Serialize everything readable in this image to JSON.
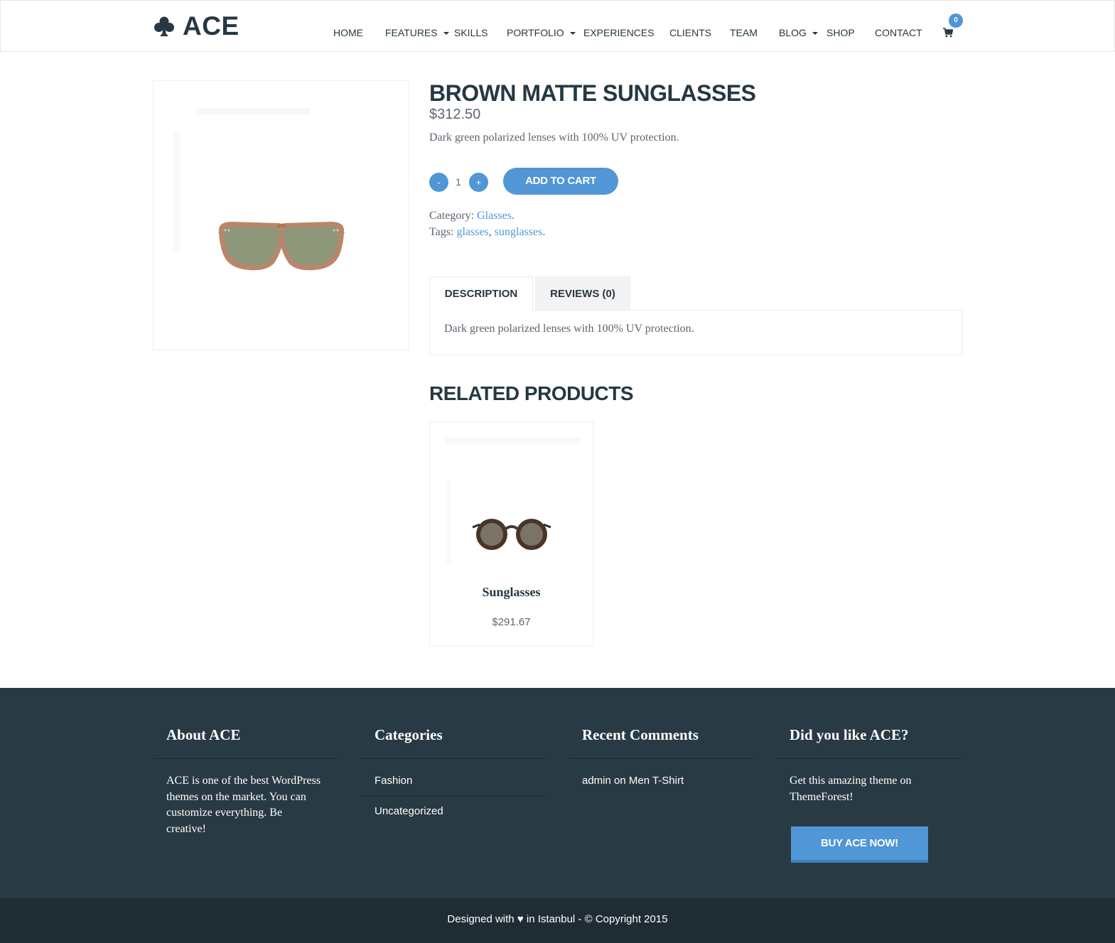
{
  "brand": {
    "logo_icon": "club-suit-icon",
    "name": "ACE"
  },
  "nav": {
    "items": [
      {
        "label": "HOME",
        "has_dropdown": false
      },
      {
        "label": "FEATURES",
        "has_dropdown": true
      },
      {
        "label": "SKILLS",
        "has_dropdown": false
      },
      {
        "label": "PORTFOLIO",
        "has_dropdown": true
      },
      {
        "label": "EXPERIENCES",
        "has_dropdown": false
      },
      {
        "label": "CLIENTS",
        "has_dropdown": false
      },
      {
        "label": "TEAM",
        "has_dropdown": false
      },
      {
        "label": "BLOG",
        "has_dropdown": true
      },
      {
        "label": "SHOP",
        "has_dropdown": false
      },
      {
        "label": "CONTACT",
        "has_dropdown": false
      }
    ],
    "cart_icon": "shopping-cart-icon",
    "cart_count": "0"
  },
  "product": {
    "title": "BROWN MATTE SUNGLASSES",
    "price": "$312.50",
    "short_description": "Dark green polarized lenses with 100% UV protection.",
    "quantity": {
      "decrease_label": "-",
      "value": "1",
      "increase_label": "+"
    },
    "add_to_cart_label": "ADD TO CART",
    "category_label": "Category:",
    "category": "Glasses",
    "tags_label": "Tags:",
    "tags": [
      "glasses",
      "sunglasses"
    ]
  },
  "tabs": {
    "items": [
      {
        "label": "DESCRIPTION",
        "active": true
      },
      {
        "label": "REVIEWS (0)",
        "active": false
      }
    ],
    "description_text": "Dark green polarized lenses with 100% UV protection."
  },
  "related": {
    "title": "RELATED PRODUCTS",
    "products": [
      {
        "name": "Sunglasses",
        "price": "$291.67"
      }
    ]
  },
  "footer": {
    "about": {
      "title": "About ACE",
      "text": "ACE is one of the best WordPress themes on the market. You can customize everything. Be creative!"
    },
    "categories": {
      "title": "Categories",
      "items": [
        "Fashion",
        "Uncategorized"
      ]
    },
    "recent_comments": {
      "title": "Recent Comments",
      "comment": {
        "author": "admin",
        "connector": "on",
        "post": "Men T-Shirt"
      }
    },
    "promo": {
      "title": "Did you like ACE?",
      "text": "Get this amazing theme on ThemeForest!",
      "button_label": "BUY ACE NOW!"
    },
    "copyright": {
      "before_icon": "Designed with",
      "icon": "heart-icon",
      "after_icon": "in Istanbul - © Copyright 2015"
    }
  },
  "colors": {
    "accent": "#5196d6",
    "heading": "#263842",
    "footer_bg": "#283a44",
    "bottom_bar_bg": "#1f2c33"
  }
}
